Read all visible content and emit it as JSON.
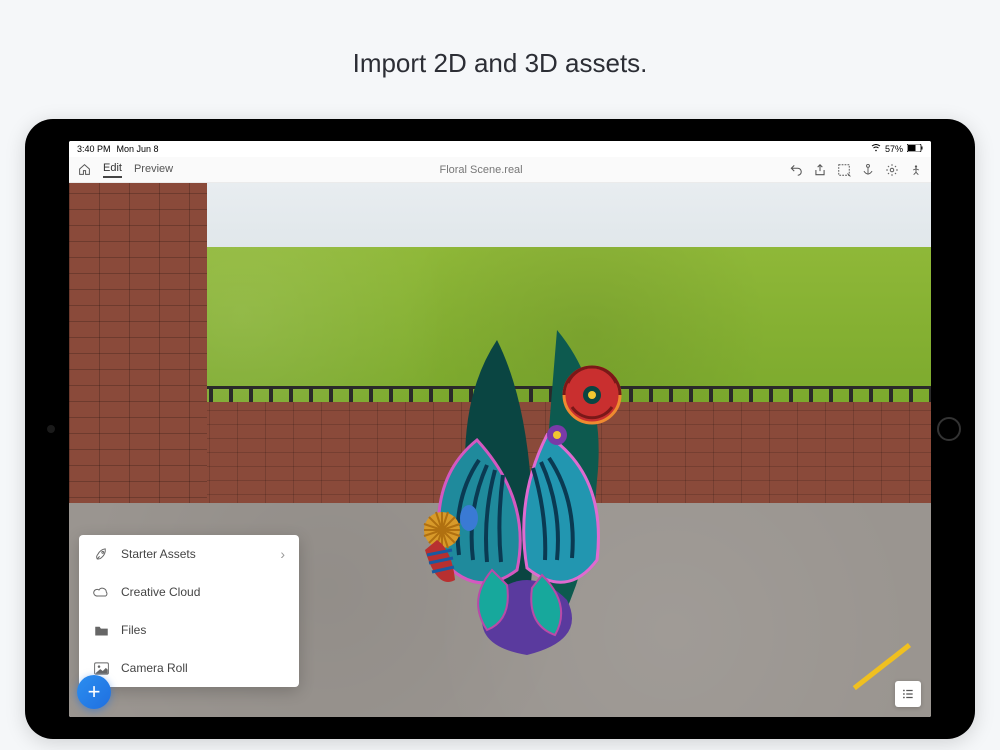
{
  "headline": "Import 2D and 3D assets.",
  "status_bar": {
    "time": "3:40 PM",
    "date": "Mon Jun 8",
    "wifi": "wifi-icon",
    "battery_pct": "57%"
  },
  "toolbar": {
    "home_icon": "home",
    "tabs": [
      {
        "label": "Edit",
        "active": true
      },
      {
        "label": "Preview",
        "active": false
      }
    ],
    "title": "Floral Scene.real",
    "right_icons": [
      "undo",
      "share",
      "select",
      "anchor",
      "settings",
      "object"
    ]
  },
  "import_menu": {
    "items": [
      {
        "icon": "rocket",
        "label": "Starter Assets",
        "has_chevron": true
      },
      {
        "icon": "cc",
        "label": "Creative Cloud",
        "has_chevron": false
      },
      {
        "icon": "folder",
        "label": "Files",
        "has_chevron": false
      },
      {
        "icon": "image",
        "label": "Camera Roll",
        "has_chevron": false
      }
    ]
  },
  "fab_label": "+",
  "colors": {
    "accent": "#1f6fe0",
    "bg": "#f5f7f9"
  }
}
